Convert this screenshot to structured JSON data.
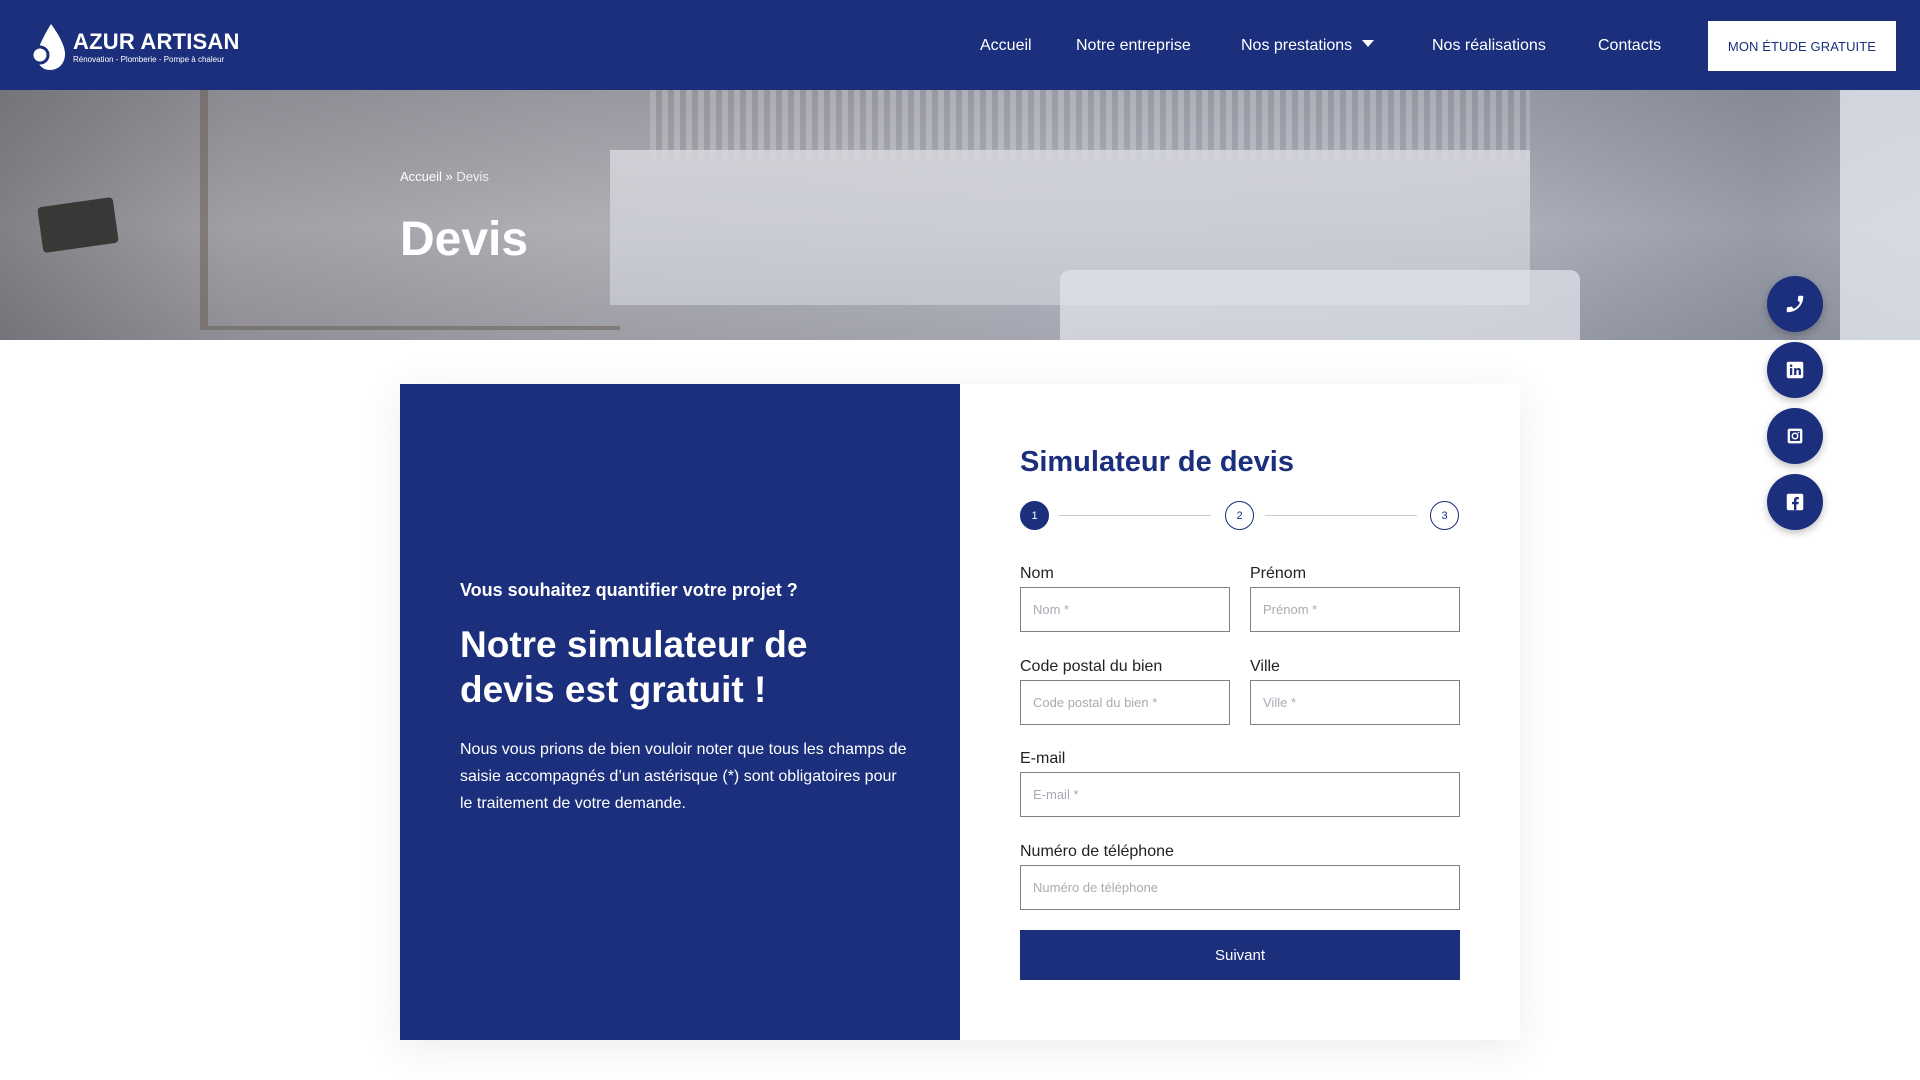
{
  "brand": {
    "name": "AZUR ARTISAN",
    "tagline": "Rénovation - Plomberie - Pompe à chaleur",
    "logo_icon": "water-drop-icon"
  },
  "nav": {
    "items": [
      {
        "label": "Accueil"
      },
      {
        "label": "Notre entreprise"
      },
      {
        "label": "Nos prestations",
        "has_dropdown": true
      },
      {
        "label": "Nos réalisations"
      },
      {
        "label": "Contacts"
      }
    ],
    "cta_label": "MON ÉTUDE GRATUITE"
  },
  "hero": {
    "breadcrumb": {
      "home": "Accueil",
      "separator": "»",
      "current": "Devis"
    },
    "title": "Devis"
  },
  "social": [
    {
      "icon": "phone-icon"
    },
    {
      "icon": "linkedin-icon"
    },
    {
      "icon": "instagram-icon"
    },
    {
      "icon": "facebook-icon"
    }
  ],
  "intro": {
    "kicker": "Vous souhaitez quantifier votre projet ?",
    "title": "Notre simulateur de devis est gratuit !",
    "text": "Nous vous prions de bien vouloir noter que tous les champs de saisie accompagnés d’un astérisque (*) sont obligatoires pour le traitement de votre demande."
  },
  "form": {
    "title": "Simulateur de devis",
    "steps": [
      "1",
      "2",
      "3"
    ],
    "current_step": 1,
    "fields": {
      "nom": {
        "label": "Nom",
        "placeholder": "Nom *",
        "value": ""
      },
      "prenom": {
        "label": "Prénom",
        "placeholder": "Prénom *",
        "value": ""
      },
      "code_postal": {
        "label": "Code postal du bien",
        "placeholder": "Code postal du bien *",
        "value": ""
      },
      "ville": {
        "label": "Ville",
        "placeholder": "Ville *",
        "value": ""
      },
      "email": {
        "label": "E-mail",
        "placeholder": "E-mail *",
        "value": ""
      },
      "telephone": {
        "label": "Numéro de téléphone",
        "placeholder": "Numéro de téléphone",
        "value": ""
      }
    },
    "submit_label": "Suivant"
  },
  "colors": {
    "primary": "#1b2f7c",
    "white": "#ffffff",
    "field_border": "#7c7f8a",
    "placeholder": "#a9abb3"
  }
}
